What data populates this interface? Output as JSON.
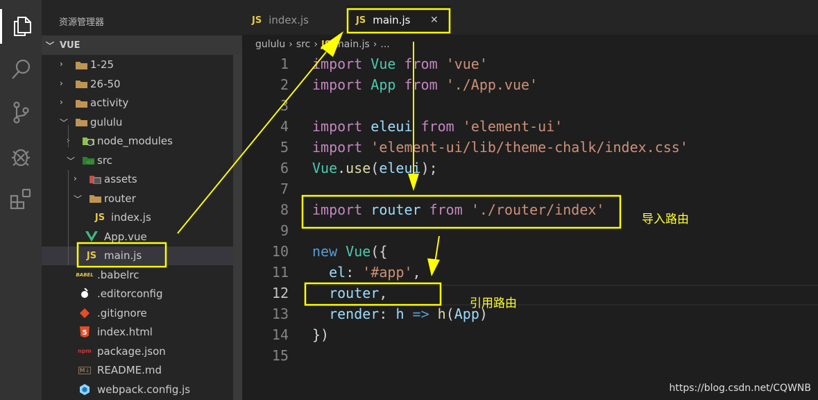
{
  "activity_bar": {
    "items": [
      {
        "name": "explorer",
        "icon": "files-icon"
      },
      {
        "name": "search",
        "icon": "search-icon"
      },
      {
        "name": "source-control",
        "icon": "source-control-icon"
      },
      {
        "name": "debug",
        "icon": "bug-icon"
      },
      {
        "name": "extensions",
        "icon": "extensions-icon"
      }
    ]
  },
  "explorer": {
    "title": "资源管理器",
    "workspace": "VUE",
    "items": [
      {
        "label": "1-25",
        "type": "folder",
        "expanded": false
      },
      {
        "label": "26-50",
        "type": "folder",
        "expanded": false
      },
      {
        "label": "activity",
        "type": "folder",
        "expanded": false
      },
      {
        "label": "gululu",
        "type": "folder",
        "expanded": true
      },
      {
        "label": "node_modules",
        "type": "folder-node",
        "expanded": false
      },
      {
        "label": "src",
        "type": "folder-src",
        "expanded": true
      },
      {
        "label": "assets",
        "type": "folder-assets",
        "expanded": false
      },
      {
        "label": "router",
        "type": "folder",
        "expanded": true
      },
      {
        "label": "index.js",
        "type": "js"
      },
      {
        "label": "App.vue",
        "type": "vue"
      },
      {
        "label": "main.js",
        "type": "js",
        "selected": true
      },
      {
        "label": ".babelrc",
        "type": "babel"
      },
      {
        "label": ".editorconfig",
        "type": "editorconfig"
      },
      {
        "label": ".gitignore",
        "type": "git"
      },
      {
        "label": "index.html",
        "type": "html"
      },
      {
        "label": "package.json",
        "type": "npm"
      },
      {
        "label": "README.md",
        "type": "markdown"
      },
      {
        "label": "webpack.config.js",
        "type": "webpack"
      }
    ],
    "js_badge": "JS"
  },
  "tabs": [
    {
      "label": "index.js",
      "active": false
    },
    {
      "label": "main.js",
      "active": true
    }
  ],
  "close_glyph": "✕",
  "breadcrumb": [
    "gululu",
    "src",
    "main.js",
    "..."
  ],
  "breadcrumb_sep": "›",
  "code": [
    [
      [
        "import",
        "kw"
      ],
      [
        " ",
        "pl"
      ],
      [
        "Vue",
        "ty"
      ],
      [
        " ",
        "pl"
      ],
      [
        "from",
        "kw"
      ],
      [
        " ",
        "pl"
      ],
      [
        "'vue'",
        "st"
      ]
    ],
    [
      [
        "import",
        "kw"
      ],
      [
        " ",
        "pl"
      ],
      [
        "App",
        "ty"
      ],
      [
        " ",
        "pl"
      ],
      [
        "from",
        "kw"
      ],
      [
        " ",
        "pl"
      ],
      [
        "'./App.vue'",
        "st"
      ]
    ],
    [],
    [
      [
        "import",
        "kw"
      ],
      [
        " ",
        "pl"
      ],
      [
        "eleui",
        "va"
      ],
      [
        " ",
        "pl"
      ],
      [
        "from",
        "kw"
      ],
      [
        " ",
        "pl"
      ],
      [
        "'element-ui'",
        "st"
      ]
    ],
    [
      [
        "import",
        "kw"
      ],
      [
        " ",
        "pl"
      ],
      [
        "'element-ui/lib/theme-chalk/index.css'",
        "st"
      ]
    ],
    [
      [
        "Vue",
        "ty"
      ],
      [
        ".",
        "pl"
      ],
      [
        "use",
        "fn"
      ],
      [
        "(",
        "pl"
      ],
      [
        "eleui",
        "va"
      ],
      [
        ");",
        "pl"
      ]
    ],
    [],
    [
      [
        "import",
        "kw"
      ],
      [
        " ",
        "pl"
      ],
      [
        "router",
        "va"
      ],
      [
        " ",
        "pl"
      ],
      [
        "from",
        "kw"
      ],
      [
        " ",
        "pl"
      ],
      [
        "'./router/index'",
        "st"
      ]
    ],
    [],
    [
      [
        "new",
        "bl"
      ],
      [
        " ",
        "pl"
      ],
      [
        "Vue",
        "ty"
      ],
      [
        "({",
        "pl"
      ]
    ],
    [
      [
        "  ",
        "pl"
      ],
      [
        "el",
        "va"
      ],
      [
        ": ",
        "pl"
      ],
      [
        "'#app'",
        "st"
      ],
      [
        ",",
        "pl"
      ]
    ],
    [
      [
        "  ",
        "pl"
      ],
      [
        "router",
        "va"
      ],
      [
        ",",
        "pl"
      ]
    ],
    [
      [
        "  ",
        "pl"
      ],
      [
        "render",
        "va"
      ],
      [
        ": ",
        "pl"
      ],
      [
        "h",
        "va"
      ],
      [
        " ",
        "pl"
      ],
      [
        "=>",
        "bl"
      ],
      [
        " ",
        "pl"
      ],
      [
        "h",
        "fn"
      ],
      [
        "(",
        "pl"
      ],
      [
        "App",
        "va"
      ],
      [
        ")",
        "pl"
      ]
    ],
    [
      [
        "})",
        "pl"
      ]
    ],
    []
  ],
  "annotations": {
    "import_note": "导入路由",
    "use_note": "引用路由",
    "highlight_color": "#ffff00"
  },
  "watermark": "https://blog.csdn.net/CQWNB"
}
